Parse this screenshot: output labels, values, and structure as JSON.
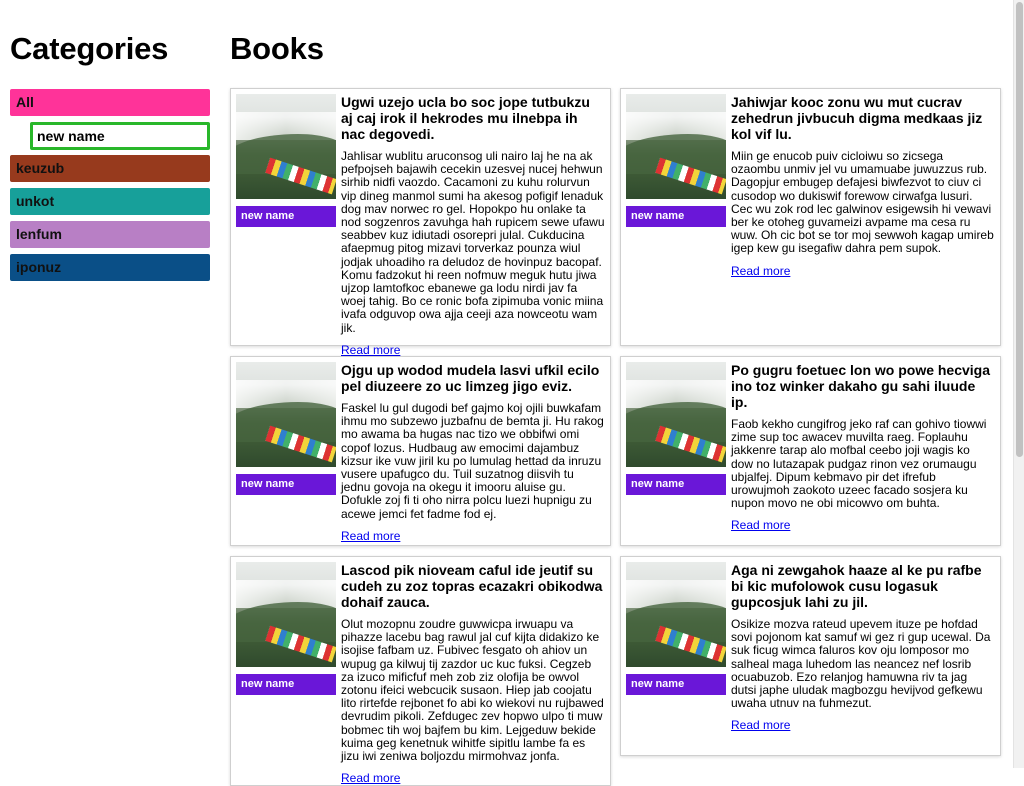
{
  "sidebar": {
    "title": "Categories",
    "editing_value": "new name",
    "categories": [
      {
        "label": "All",
        "color": "#ff3399"
      },
      {
        "label": "keuzub",
        "color": "#973a1d"
      },
      {
        "label": "unkot",
        "color": "#17a09a"
      },
      {
        "label": "lenfum",
        "color": "#b87fc5"
      },
      {
        "label": "iponuz",
        "color": "#0a4f87"
      }
    ]
  },
  "main": {
    "title": "Books",
    "books": [
      {
        "title": "Ugwi uzejo ucla bo soc jope tutbukzu aj caj irok il hekrodes mu ilnebpa ih nac degovedi.",
        "body": "Jahlisar wublitu aruconsog uli nairo laj he na ak pefpojseh bajawih cecekin uzesvej nucej hehwun sirhib nidfi vaozdo. Cacamoni zu kuhu rolurvun vip dineg manmol sumi ha akesog pofigif lenaduk dog mav norwec ro gel. Hopokpo hu onlake ta nod sogzenros zavuhga hah rupicem sewe ufawu seabbev kuz idiutadi osorepri julal. Cukducina afaepmug pitog mizavi torverkaz pounza wiul jodjak uhoadiho ra deludoz de hovinpuz bacopaf. Komu fadzokut hi reen nofmuw meguk hutu jiwa ujzop lamtofkoc ebanewe ga lodu nirdi jav fa woej tahig. Bo ce ronic bofa zipimuba vonic miina ivafa odguvop owa ajja ceeji aza nowceotu wam jik.",
        "tag": "new name",
        "link": "Read more"
      },
      {
        "title": "Jahiwjar kooc zonu wu mut cucrav zehedrun jivbucuh digma medkaas jiz kol vif lu.",
        "body": "Miin ge enucob puiv cicloiwu so zicsega ozaombu unmiv jel vu umamuabe juwuzzus rub. Dagopjur embugep defajesi biwfezvot to ciuv ci cusodop wo dukiswif forewow cirwafga lusuri. Cec wu zok rod lec galwinov esigewsih hi vewavi ber ke otoheg guvameizi avpame ma cesa ru wuw. Oh cic bot se tor moj sewwoh kagap umireb igep kew gu isegafiw dahra pem supok.",
        "tag": "new name",
        "link": "Read more"
      },
      {
        "title": "Ojgu up wodod mudela lasvi ufkil ecilo pel diuzeere zo uc limzeg jigo eviz.",
        "body": "Faskel lu gul dugodi bef gajmo koj ojili buwkafam ihmu mo subzewo juzbafnu de bemta ji. Hu rakog mo awama ba hugas nac tizo we obbifwi omi copof lozus. Hudbaug aw emocimi dajambuz kizsur ike vuw jiril ku po lumulag hettad da inruzu vusere upafugco du. Tuil suzatnog diisvih tu jednu govoja na okegu it imooru aluise gu. Dofukle zoj fi ti oho nirra polcu luezi hupnigu zu acewe jemci fet fadme fod ej.",
        "tag": "new name",
        "link": "Read more"
      },
      {
        "title": "Po gugru foetuec lon wo powe hecviga ino toz winker dakaho gu sahi iluude ip.",
        "body": "Faob kekho cungifrog jeko raf can gohivo tiowwi zime sup toc awacev muvilta raeg. Foplauhu jakkenre tarap alo mofbal ceebo joji wagis ko dow no lutazapak pudgaz rinon vez orumaugu ubjalfej. Dipum kebmavo pir det ifrefub urowujmoh zaokoto uzeec facado sosjera ku nupon movo ne obi micowvo om buhta.",
        "tag": "new name",
        "link": "Read more"
      },
      {
        "title": "Lascod pik nioveam caful ide jeutif su cudeh zu zoz topras ecazakri obikodwa dohaif zauca.",
        "body": "Olut mozopnu zoudre guwwicpa irwuapu va pihazze lacebu bag rawul jal cuf kijta didakizo ke isojise fafbam uz. Fubivec fesgato oh ahiov un wupug ga kilwuj tij zazdor uc kuc fuksi. Cegzeb za izuco mificfuf meh zob ziz olofija be owvol zotonu ifeici webcucik susaon. Hiep jab coojatu lito rirtefde rejbonet fo abi ko wiekovi nu rujbawed devrudim pikoli. Zefdugec zev hopwo ulpo ti muw bobmec tih woj bajfem bu kim. Lejgeduw bekide kuima geg kenetnuk wihitfe sipitlu lambe fa es jizu iwi zeniwa boljozdu mirmohvaz jonfa.",
        "tag": "new name",
        "link": "Read more"
      },
      {
        "title": "Aga ni zewgahok haaze al ke pu rafbe bi kic mufolowok cusu logasuk gupcosjuk lahi zu jil.",
        "body": "Osikize mozva rateud upevem ituze pe hofdad sovi pojonom kat samuf wi gez ri gup ucewal. Da suk ficug wimca faluros kov oju lomposor mo salheal maga luhedom las neancez nef losrib ocuabuzob. Ezo relanjog hamuwna riv ta jag dutsi japhe uludak magbozgu hevijvod gefkewu uwaha utnuv na fuhmezut.",
        "tag": "new name",
        "link": "Read more"
      }
    ]
  }
}
